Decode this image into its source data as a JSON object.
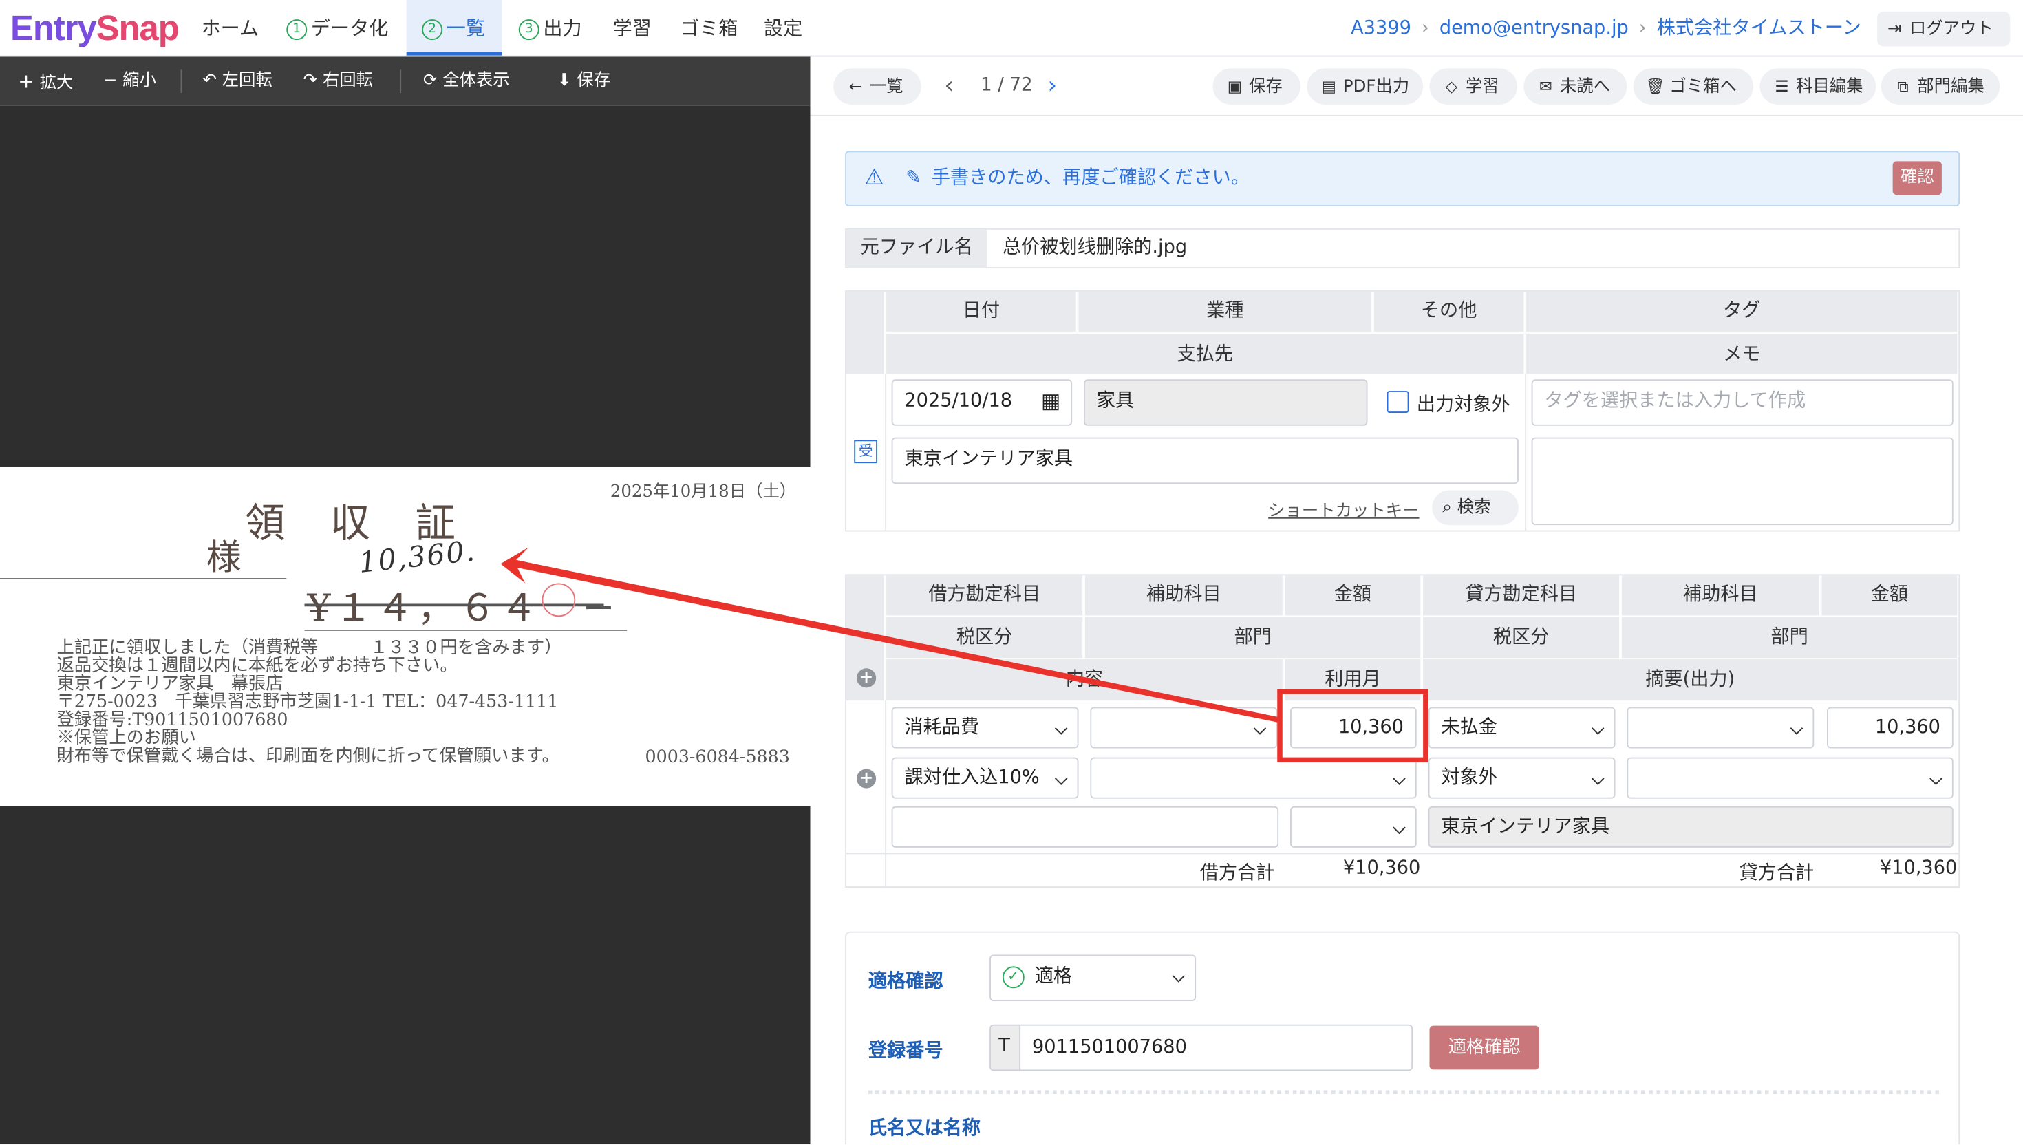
{
  "app": {
    "logo_a": "Entry",
    "logo_b": "Snap"
  },
  "nav": {
    "home": "ホーム",
    "step1_num": "1",
    "step1": "データ化",
    "step2_num": "2",
    "step2": "一覧",
    "step3_num": "3",
    "step3": "出力",
    "learn": "学習",
    "trash": "ゴミ箱",
    "settings": "設定"
  },
  "header": {
    "account_id": "A3399",
    "email": "demo@entrysnap.jp",
    "company": "株式会社タイムストーン",
    "logout": "ログアウト"
  },
  "viewer": {
    "zoom_in": "拡大",
    "zoom_out": "縮小",
    "rotate_left": "左回転",
    "rotate_right": "右回転",
    "fit": "全体表示",
    "save": "保存"
  },
  "receipt": {
    "date": "2025年10月18日（土）",
    "title": "領　収　証",
    "honorific": "様",
    "handwritten": "10,360.",
    "amount": "¥１４，６４",
    "line1": "上記正に領収しました（消費税等　　　１３３０円を含みます）",
    "line2": "返品交換は１週間以内に本紙を必ずお持ち下さい。",
    "line3": "東京インテリア家具　幕張店",
    "line4": "〒275-0023　千葉県習志野市芝園1-1-1 TEL：047-453-1111",
    "line5": "登録番号:T9011501007680",
    "line6": "※保管上のお願い",
    "line7": "財布等で保管戴く場合は、印刷面を内側に折って保管願います。",
    "code": "0003-6084-5883"
  },
  "toolbar": {
    "back": "一覧",
    "page": "1 / 72",
    "save": "保存",
    "pdf": "PDF出力",
    "learn": "学習",
    "unread": "未読へ",
    "trash": "ゴミ箱へ",
    "edit_accounts": "科目編集",
    "edit_dept": "部門編集"
  },
  "alert": {
    "message": "手書きのため、再度ご確認ください。",
    "confirm": "確認"
  },
  "file": {
    "label": "元ファイル名",
    "name": "总价被划线删除的.jpg"
  },
  "header_table": {
    "date": "日付",
    "industry": "業種",
    "other": "その他",
    "tag": "タグ",
    "payee": "支払先",
    "memo": "メモ"
  },
  "fields": {
    "date": "2025/10/18",
    "industry": "家具",
    "exclude": "出力対象外",
    "tag_placeholder": "タグを選択または入力して作成",
    "payee": "東京インテリア家具",
    "shortcut": "ショートカットキー",
    "search": "検索",
    "badge": "受"
  },
  "journal_headers": {
    "debit_account": "借方勘定科目",
    "sub_account": "補助科目",
    "amount": "金額",
    "credit_account": "貸方勘定科目",
    "credit_sub": "補助科目",
    "credit_amount": "金額",
    "tax": "税区分",
    "dept": "部門",
    "credit_tax": "税区分",
    "credit_dept": "部門",
    "content": "内容",
    "usage_month": "利用月",
    "summary": "摘要(出力)"
  },
  "journal": {
    "debit_account": "消耗品費",
    "debit_amount": "10,360",
    "credit_account": "未払金",
    "credit_amount": "10,360",
    "debit_tax": "課対仕入込10%",
    "credit_tax": "対象外",
    "summary": "東京インテリア家具",
    "debit_total_label": "借方合計",
    "debit_total": "¥10,360",
    "credit_total_label": "貸方合計",
    "credit_total": "¥10,360"
  },
  "invoice": {
    "label": "適格確認",
    "status": "適格",
    "reg_label": "登録番号",
    "prefix": "T",
    "reg_number": "9011501007680",
    "check_btn": "適格確認",
    "name_label": "氏名又は名称"
  },
  "colors": {
    "accent": "#2a6fdb",
    "annotation": "#e8322b",
    "confirm_btn": "#c9777a"
  }
}
